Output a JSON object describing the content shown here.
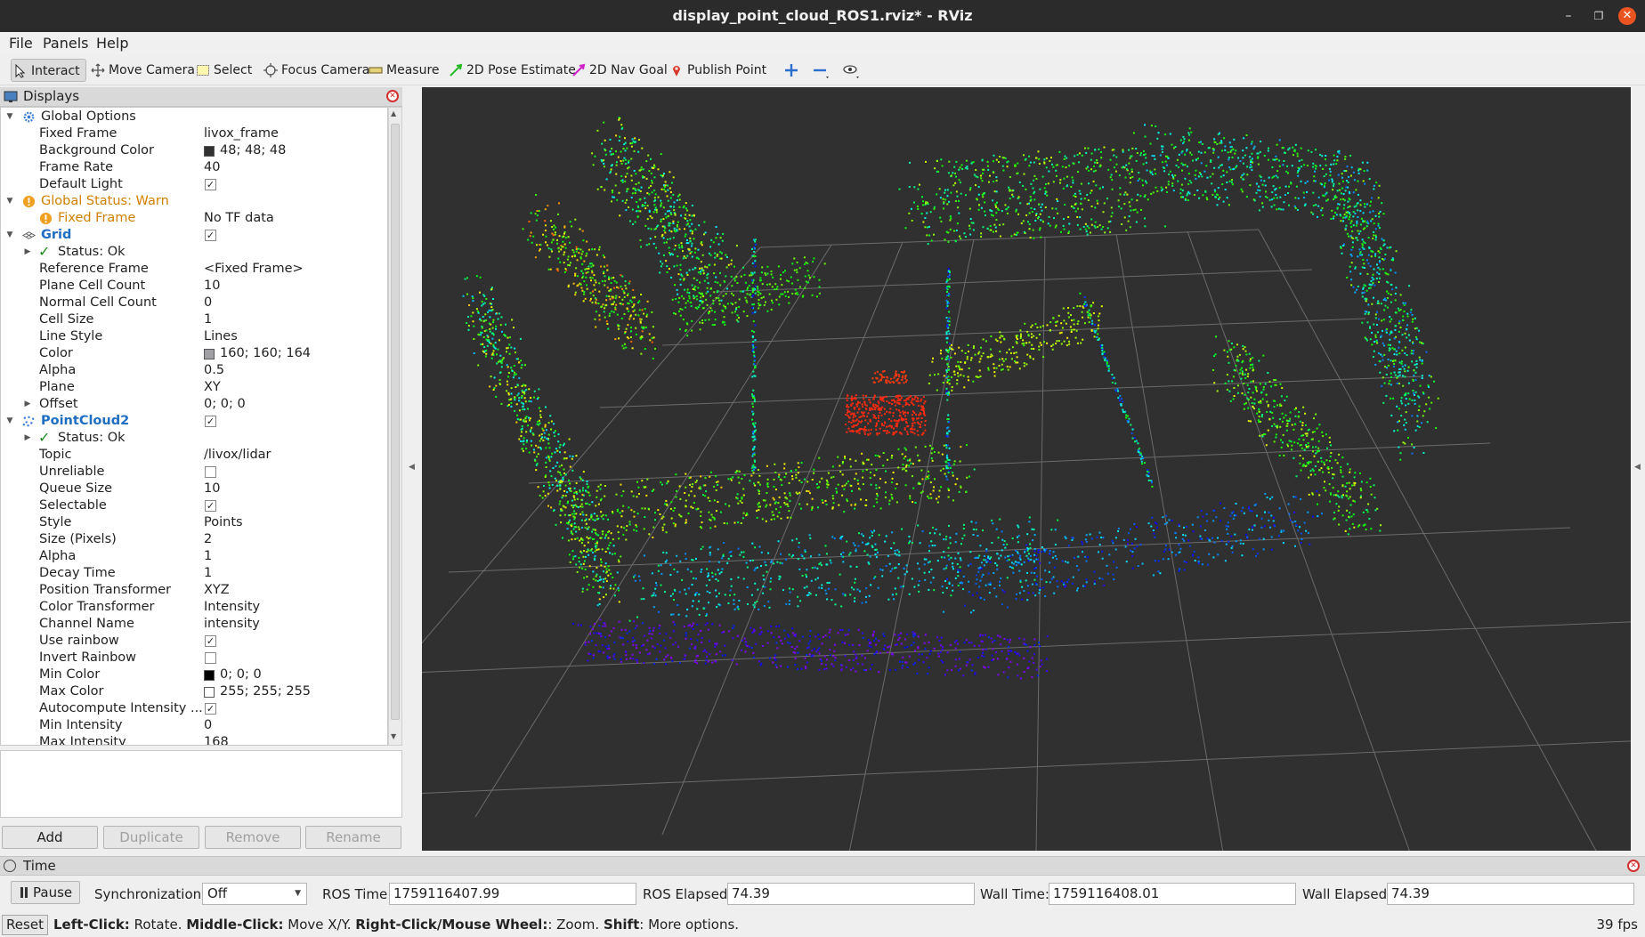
{
  "window": {
    "title": "display_point_cloud_ROS1.rviz* - RViz"
  },
  "menu": [
    "File",
    "Panels",
    "Help"
  ],
  "toolbar": {
    "interact": "Interact",
    "move_camera": "Move Camera",
    "select": "Select",
    "focus_camera": "Focus Camera",
    "measure": "Measure",
    "pose_estimate": "2D Pose Estimate",
    "nav_goal": "2D Nav Goal",
    "publish_point": "Publish Point"
  },
  "displays": {
    "header": "Displays",
    "global_options": "Global Options",
    "fixed_frame_k": "Fixed Frame",
    "fixed_frame_v": "livox_frame",
    "bg_color_k": "Background Color",
    "bg_color_v": "48; 48; 48",
    "frame_rate_k": "Frame Rate",
    "frame_rate_v": "40",
    "default_light_k": "Default Light",
    "global_status": "Global Status: Warn",
    "status_fixed_frame_k": "Fixed Frame",
    "status_fixed_frame_v": "No TF data",
    "grid": "Grid",
    "grid_status": "Status: Ok",
    "ref_frame_k": "Reference Frame",
    "ref_frame_v": "<Fixed Frame>",
    "plane_cell_k": "Plane Cell Count",
    "plane_cell_v": "10",
    "normal_cell_k": "Normal Cell Count",
    "normal_cell_v": "0",
    "cell_size_k": "Cell Size",
    "cell_size_v": "1",
    "line_style_k": "Line Style",
    "line_style_v": "Lines",
    "color_k": "Color",
    "color_v": "160; 160; 164",
    "alpha_k": "Alpha",
    "alpha_v": "0.5",
    "plane_k": "Plane",
    "plane_v": "XY",
    "offset_k": "Offset",
    "offset_v": "0; 0; 0",
    "pc2": "PointCloud2",
    "pc2_status": "Status: Ok",
    "topic_k": "Topic",
    "topic_v": "/livox/lidar",
    "unreliable_k": "Unreliable",
    "queue_k": "Queue Size",
    "queue_v": "10",
    "selectable_k": "Selectable",
    "style_k": "Style",
    "style_v": "Points",
    "size_k": "Size (Pixels)",
    "size_v": "2",
    "pc_alpha_k": "Alpha",
    "pc_alpha_v": "1",
    "decay_k": "Decay Time",
    "decay_v": "1",
    "pos_tf_k": "Position Transformer",
    "pos_tf_v": "XYZ",
    "col_tf_k": "Color Transformer",
    "col_tf_v": "Intensity",
    "channel_k": "Channel Name",
    "channel_v": "intensity",
    "rainbow_k": "Use rainbow",
    "invert_k": "Invert Rainbow",
    "min_color_k": "Min Color",
    "min_color_v": "0; 0; 0",
    "max_color_k": "Max Color",
    "max_color_v": "255; 255; 255",
    "autocompute_k": "Autocompute Intensity ...",
    "min_int_k": "Min Intensity",
    "min_int_v": "0",
    "max_int_k": "Max Intensity",
    "max_int_v": "168",
    "buttons": {
      "add": "Add",
      "duplicate": "Duplicate",
      "remove": "Remove",
      "rename": "Rename"
    }
  },
  "colors": {
    "bg": "#303030",
    "grid": "#a0a0a4",
    "warn": "#d08000",
    "accent": "#1f6ec2"
  },
  "time": {
    "header": "Time",
    "pause": "Pause",
    "sync_label": "Synchronization:",
    "sync_value": "Off",
    "ros_time_label": "ROS Time:",
    "ros_time": "1759116407.99",
    "ros_elapsed_label": "ROS Elapsed:",
    "ros_elapsed": "74.39",
    "wall_time_label": "Wall Time:",
    "wall_time": "1759116408.01",
    "wall_elapsed_label": "Wall Elapsed:",
    "wall_elapsed": "74.39"
  },
  "status": {
    "reset": "Reset",
    "h1b": "Left-Click:",
    "h1": " Rotate. ",
    "h2b": "Middle-Click:",
    "h2": " Move X/Y. ",
    "h3b": "Right-Click/Mouse Wheel:",
    "h3": ": Zoom. ",
    "h4b": "Shift",
    "h4": ": More options.",
    "fps": "39 fps"
  }
}
